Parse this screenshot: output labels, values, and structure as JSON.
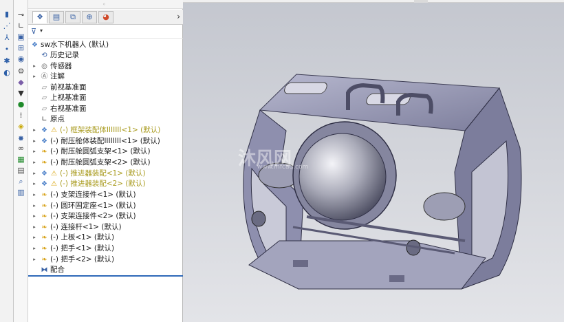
{
  "command_strip": {
    "icons": [
      "part-icon",
      "sketch-icon",
      "axis-icon",
      "dot-icon",
      "gear-icon",
      "surface-icon"
    ]
  },
  "icon_column": {
    "icons": [
      "measure-icon",
      "dimension-icon",
      "display-icon",
      "hierarchy-icon",
      "appearance-icon",
      "settings-icon",
      "component-icon",
      "shell-icon",
      "location-icon",
      "hole-icon",
      "mate-icon",
      "explode-icon",
      "binoculars-icon",
      "table-icon",
      "sheet-icon",
      "print-icon",
      "search-icon",
      "chart-icon"
    ]
  },
  "tabs": {
    "items": [
      "feature-manager-tab",
      "property-manager-tab",
      "configuration-manager-tab",
      "dimxpert-tab",
      "display-manager-tab"
    ],
    "more": "›"
  },
  "filter": {
    "icon": "filter-icon",
    "caret": "▾"
  },
  "tree": {
    "root": "sw水下机器人 (默认)",
    "items": [
      {
        "label": "历史记录",
        "icon": "history-icon",
        "expand": false,
        "warn": false
      },
      {
        "label": "传感器",
        "icon": "sensor-icon",
        "expand": true,
        "warn": false
      },
      {
        "label": "注解",
        "icon": "annotation-icon",
        "expand": true,
        "warn": false
      },
      {
        "label": "前视基准面",
        "icon": "plane-icon",
        "expand": false,
        "warn": false
      },
      {
        "label": "上视基准面",
        "icon": "plane-icon",
        "expand": false,
        "warn": false
      },
      {
        "label": "右视基准面",
        "icon": "plane-icon",
        "expand": false,
        "warn": false
      },
      {
        "label": "原点",
        "icon": "origin-icon",
        "expand": false,
        "warn": false
      },
      {
        "label": "(-) 框架装配体IIIIIII<1> (默认)",
        "icon": "assembly-icon",
        "expand": true,
        "warn": true
      },
      {
        "label": "(-) 耐压舱体装配IIIIIIII<1> (默认)",
        "icon": "assembly-icon",
        "expand": true,
        "warn": false
      },
      {
        "label": "(-) 耐压舱圆弧支架<1> (默认)",
        "icon": "part-icon",
        "expand": true,
        "warn": false
      },
      {
        "label": "(-) 耐压舱圆弧支架<2> (默认)",
        "icon": "part-icon",
        "expand": true,
        "warn": false
      },
      {
        "label": "(-) 推进器装配<1> (默认)",
        "icon": "assembly-icon",
        "expand": true,
        "warn": true
      },
      {
        "label": "(-) 推进器装配<2> (默认)",
        "icon": "assembly-icon",
        "expand": true,
        "warn": true
      },
      {
        "label": "(-) 支架连接件<1> (默认)",
        "icon": "part-icon",
        "expand": true,
        "warn": false
      },
      {
        "label": "(-) 圆环固定座<1> (默认)",
        "icon": "part-icon",
        "expand": true,
        "warn": false
      },
      {
        "label": "(-) 支架连接件<2> (默认)",
        "icon": "part-icon",
        "expand": true,
        "warn": false
      },
      {
        "label": "(-) 连接杆<1> (默认)",
        "icon": "part-icon",
        "expand": true,
        "warn": false
      },
      {
        "label": "(-) 上板<1> (默认)",
        "icon": "part-icon",
        "expand": true,
        "warn": false
      },
      {
        "label": "(-) 把手<1> (默认)",
        "icon": "part-icon",
        "expand": true,
        "warn": false
      },
      {
        "label": "(-) 把手<2> (默认)",
        "icon": "part-icon",
        "expand": true,
        "warn": false
      },
      {
        "label": "配合",
        "icon": "mates-icon",
        "expand": false,
        "warn": false
      }
    ]
  },
  "viewport": {
    "watermark": "沐风网",
    "watermark_sub": "www.mfcad.com",
    "colors": {
      "frame": "#8f8fb0",
      "frame_dark": "#5a5a78",
      "sphere": "#b9bac4",
      "background_top": "#c4c7cf"
    }
  }
}
